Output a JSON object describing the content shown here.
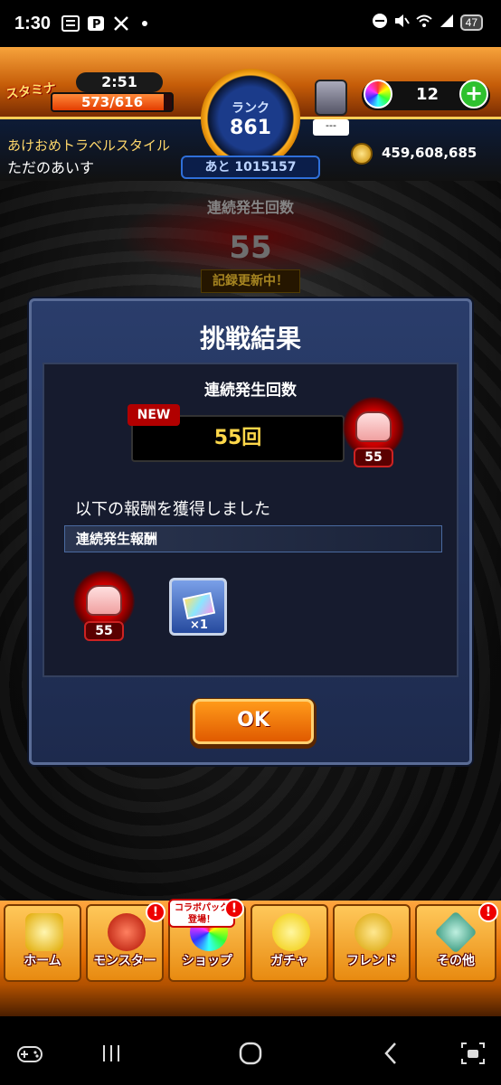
{
  "status_bar": {
    "time": "1:30",
    "battery": "47"
  },
  "header": {
    "stamina_label": "スタミナ",
    "timer": "2:51",
    "stamina_text": "573/616",
    "stamina_fraction": 0.93,
    "rank_label": "ランク",
    "rank_value": "861",
    "rank_next": "あと 1015157",
    "gem_box_value": "---",
    "orb_count": "12",
    "player_title": "あけおめトラベルスタイル",
    "player_name": "ただのあいす",
    "coins": "459,608,685"
  },
  "background": {
    "count_label": "連続発生回数",
    "count_value": "55",
    "record_text": "記録更新中！"
  },
  "dialog": {
    "title": "挑戦結果",
    "count_label": "連続発生回数",
    "new_badge": "NEW",
    "count_value": "55回",
    "fist_badge_value": "55",
    "reward_heading": "以下の報酬を獲得しました",
    "reward_category": "連続発生報酬",
    "reward_fist_value": "55",
    "ticket_qty": "×1",
    "ok_label": "OK"
  },
  "menu": {
    "items": [
      {
        "label": "ホーム",
        "icon": "home-icon"
      },
      {
        "label": "モンスター",
        "icon": "monster-icon"
      },
      {
        "label": "ショップ",
        "icon": "shop-icon"
      },
      {
        "label": "ガチャ",
        "icon": "gacha-icon"
      },
      {
        "label": "フレンド",
        "icon": "friend-icon"
      },
      {
        "label": "その他",
        "icon": "other-icon"
      }
    ],
    "collab_tag_line1": "コラボパック",
    "collab_tag_line2": "登場！",
    "alert_mark": "!"
  },
  "colors": {
    "accent_orange": "#e06a00",
    "dialog_blue": "#2a3d6b",
    "gold_text": "#ffd84a"
  }
}
